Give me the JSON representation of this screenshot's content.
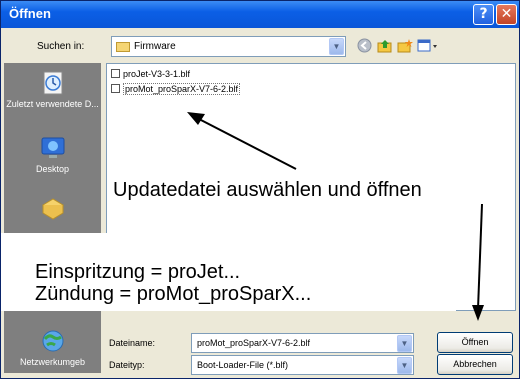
{
  "window": {
    "title": "Öffnen",
    "help_glyph": "?",
    "close_glyph": "✕"
  },
  "toolbar": {
    "look_in_label": "Suchen in:",
    "look_in_value": "Firmware",
    "tools": [
      "back-icon",
      "up-folder-icon",
      "new-folder-icon",
      "view-menu-icon"
    ]
  },
  "places": [
    {
      "label": "Zuletzt verwendete D...",
      "icon": "recent-documents-icon"
    },
    {
      "label": "Desktop",
      "icon": "desktop-icon"
    },
    {
      "label": "",
      "icon": "my-documents-icon"
    },
    {
      "label": "Netzwerkumgeb",
      "icon": "network-icon"
    }
  ],
  "files": [
    {
      "name": "proJet-V3-3-1.blf"
    },
    {
      "name": "proMot_proSparX-V7-6-2.blf"
    }
  ],
  "annotations": {
    "update": "Updatedatei auswählen und öffnen",
    "line1": "Einspritzung = proJet...",
    "line2": "Zündung = proMot_proSparX..."
  },
  "bottom": {
    "filename_label": "Dateiname:",
    "filename_value": "proMot_proSparX-V7-6-2.blf",
    "filetype_label": "Dateityp:",
    "filetype_value": "Boot-Loader-File (*.blf)",
    "open_button": "Öffnen",
    "cancel_button": "Abbrechen"
  },
  "colors": {
    "titlebar": "#0b5fe6",
    "dialog_bg": "#ece9d8",
    "places_bar": "#7f7f7f"
  }
}
